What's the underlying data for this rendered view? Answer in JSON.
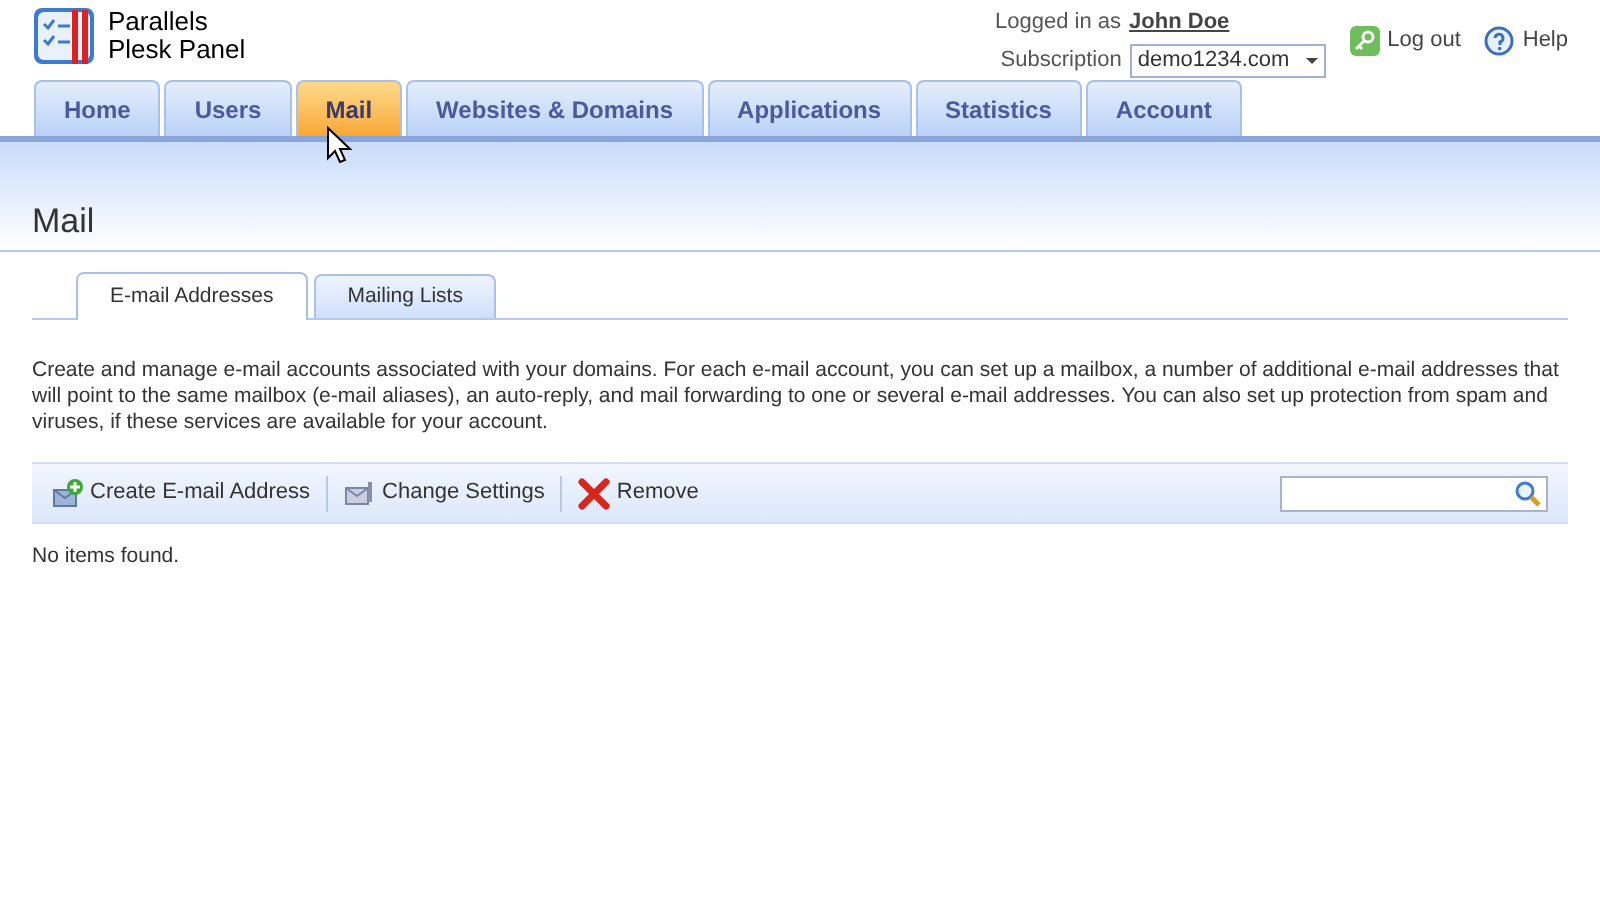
{
  "header": {
    "product_line_1": "Parallels",
    "product_line_2": "Plesk Panel",
    "logged_in_label": "Logged in as",
    "user_name": "John Doe",
    "subscription_label": "Subscription",
    "subscription_value": "demo1234.com",
    "logout": "Log out",
    "help": "Help"
  },
  "tabs": [
    {
      "label": "Home",
      "selected": false
    },
    {
      "label": "Users",
      "selected": false
    },
    {
      "label": "Mail",
      "selected": true
    },
    {
      "label": "Websites & Domains",
      "selected": false
    },
    {
      "label": "Applications",
      "selected": false
    },
    {
      "label": "Statistics",
      "selected": false
    },
    {
      "label": "Account",
      "selected": false
    }
  ],
  "page_title": "Mail",
  "subtabs": [
    {
      "label": "E-mail Addresses",
      "selected": true
    },
    {
      "label": "Mailing Lists",
      "selected": false
    }
  ],
  "description": "Create and manage e-mail accounts associated with your domains. For each e-mail account, you can set up a mailbox, a number of additional e-mail addresses that will point to the same mailbox (e-mail aliases), an auto-reply, and mail forwarding to one or several e-mail addresses. You can also set up protection from spam and viruses, if these services are available for your account.",
  "toolbar": [
    {
      "kind": "create",
      "label": "Create E-mail Address"
    },
    {
      "kind": "settings",
      "label": "Change Settings"
    },
    {
      "kind": "remove",
      "label": "Remove"
    }
  ],
  "empty_message": "No items found."
}
